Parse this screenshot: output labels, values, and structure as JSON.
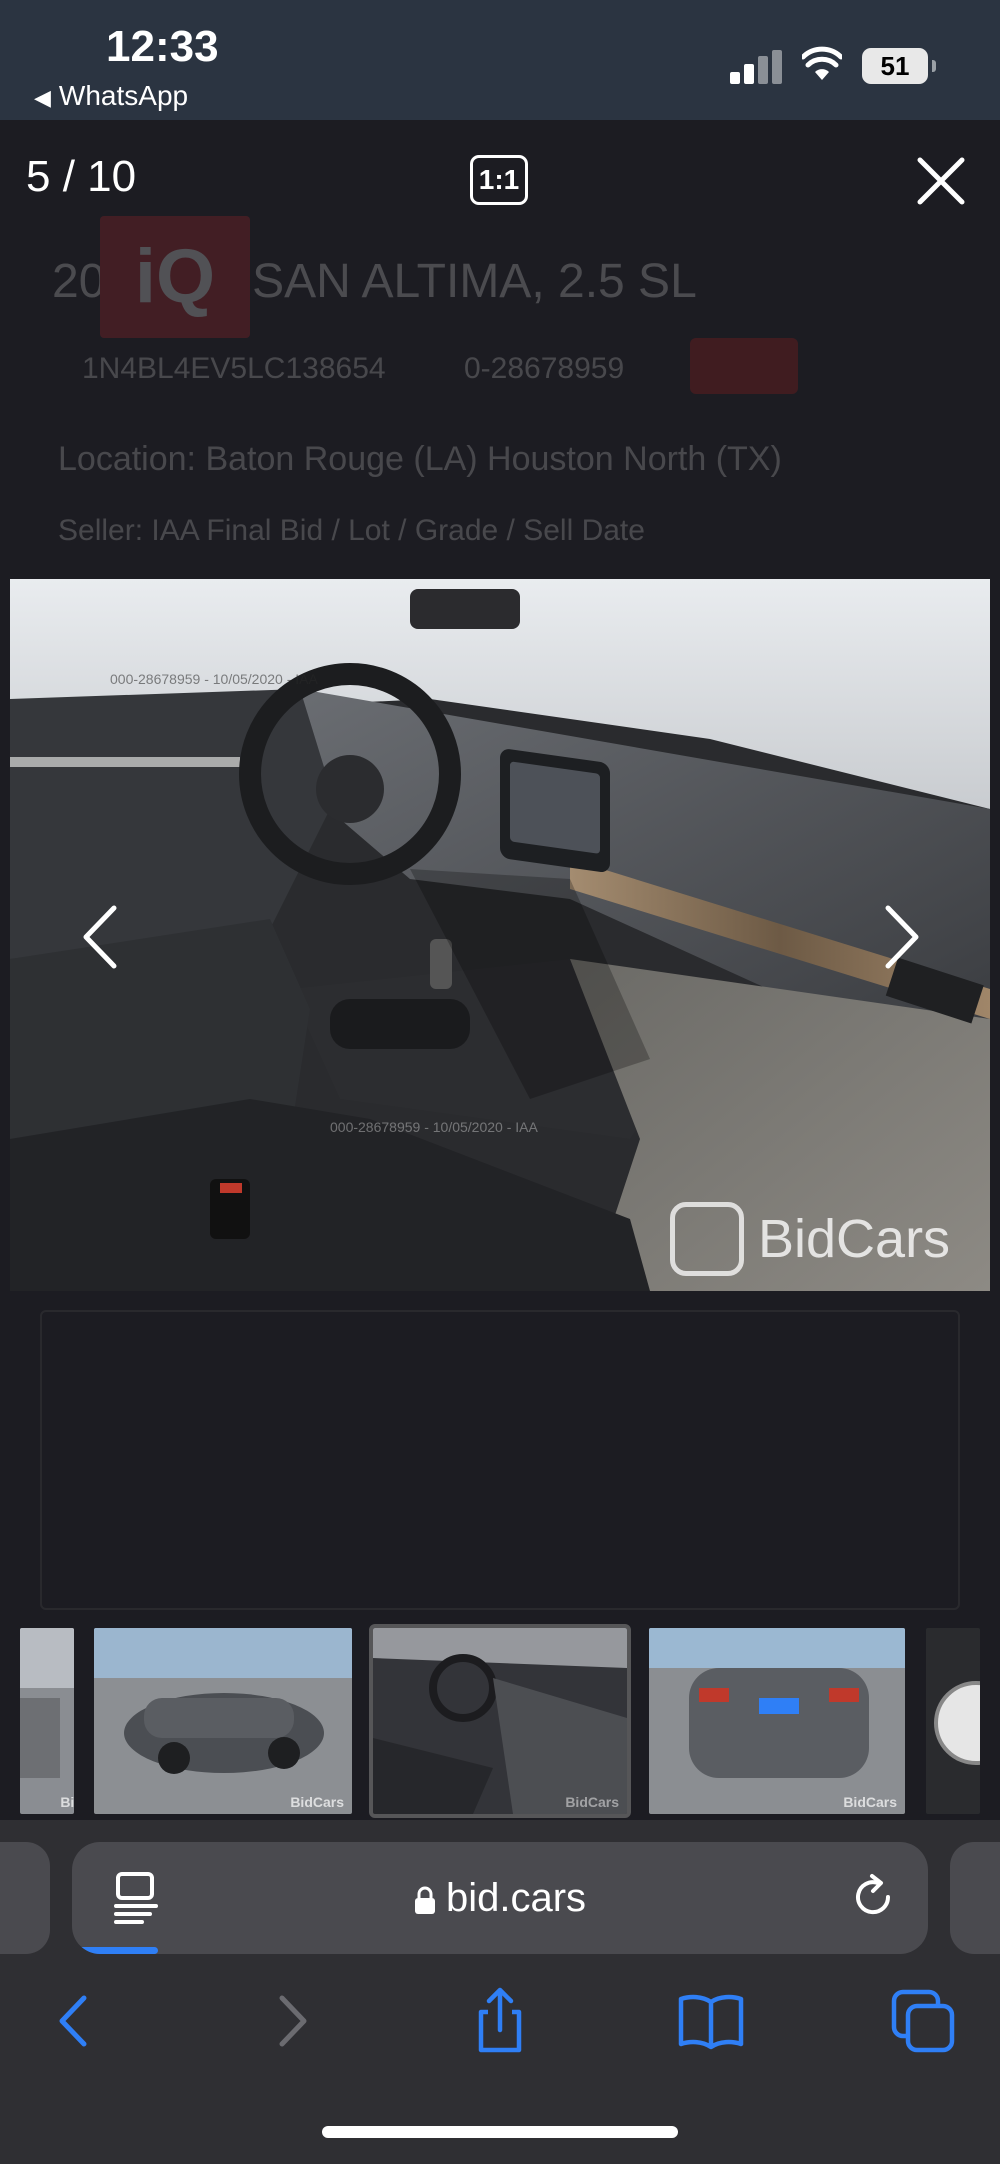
{
  "status_bar": {
    "time": "12:33",
    "back_app": "WhatsApp",
    "battery": "51"
  },
  "background_page": {
    "logo_text": "iQ",
    "title": "2020 NISSAN ALTIMA, 2.5 SL",
    "vin": "1N4BL4EV5LC138654",
    "lot": "0-28678959",
    "location": "Location: Baton Rouge (LA) Houston North (TX)",
    "sale": "Seller: IAA Final Bid / Lot / Grade / Sell Date"
  },
  "viewer": {
    "counter": "5 / 10",
    "ratio_label": "1:1",
    "close_icon": "close-icon",
    "prev_icon": "chevron-left-icon",
    "next_icon": "chevron-right-icon"
  },
  "photo": {
    "watermark_top": "000-28678959 - 10/05/2020 - IAA",
    "watermark_bottom": "000-28678959 - 10/05/2020 - IAA",
    "brand_watermark": "BidCars"
  },
  "thumbnails": [
    {
      "label": "BidCars"
    },
    {
      "label": "BidCars"
    },
    {
      "label": "BidCars"
    },
    {
      "label": "BidCars"
    },
    {
      "label": ""
    }
  ],
  "safari": {
    "url": "bid.cars",
    "reader_icon": "reader-icon",
    "reload_icon": "reload-icon",
    "toolbar": {
      "back": "back-icon",
      "forward": "forward-icon",
      "share": "share-icon",
      "bookmarks": "bookmarks-icon",
      "tabs": "tabs-icon"
    }
  },
  "colors": {
    "accent": "#2f7ff6",
    "status_bar_bg": "#2b3441",
    "page_bg": "#1c1c22",
    "safari_bg": "#2f2f33"
  }
}
